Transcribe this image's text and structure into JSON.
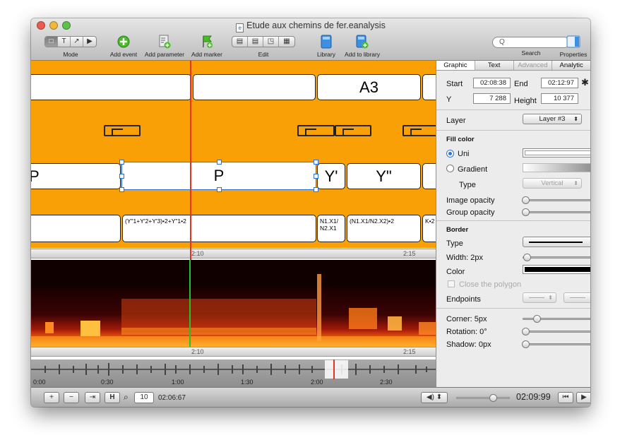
{
  "window": {
    "title": "Etude aux chemins de fer.eanalysis"
  },
  "toolbar": {
    "mode_label": "Mode",
    "mode_buttons": [
      "□",
      "T",
      "↗",
      "▶"
    ],
    "add_event": "Add event",
    "add_parameter": "Add parameter",
    "add_marker": "Add marker",
    "edit_label": "Edit",
    "library": "Library",
    "add_to_library": "Add to library",
    "search_label": "Search",
    "search_placeholder": "Q",
    "properties": "Properties"
  },
  "timeline": {
    "row1": {
      "text": "A3"
    },
    "row3": {
      "p": "P",
      "yprime": "Y'",
      "ydouble": "Y\"",
      "left": "P"
    },
    "row4": {
      "formula": "(Y\"1+Y'2+Y'3)•2+Y\"1•2",
      "n1": "N1.X1/ N2.X1",
      "n2": "(N1.X1/N2.X2)•2",
      "k": "K•2"
    },
    "ruler": {
      "mark1": "2:10",
      "mark2": "2:15"
    },
    "ruler2": {
      "mark1": "2:10",
      "mark2": "2:15"
    },
    "overview": [
      "0:00",
      "0:30",
      "1:00",
      "1:30",
      "2:00",
      "2:30"
    ]
  },
  "bottombar": {
    "plus": "+",
    "minus": "−",
    "fit": "⇥",
    "h": "H",
    "zoom": "10",
    "time": "02:06:67",
    "playtime": "02:09:99",
    "rewind": "⏮",
    "play": "▶"
  },
  "inspector": {
    "tabs": [
      "Graphic",
      "Text",
      "Advanced",
      "Analytic"
    ],
    "start_label": "Start",
    "start": "02:08:38",
    "end_label": "End",
    "end": "02:12:97",
    "y_label": "Y",
    "y": "7 288",
    "height_label": "Height",
    "height": "10 377",
    "layer_label": "Layer",
    "layer_value": "Layer #3",
    "fill_color": "Fill color",
    "uni": "Uni",
    "gradient": "Gradient",
    "type_label": "Type",
    "type_value": "Vertical",
    "image_opacity": "Image opacity",
    "group_opacity": "Group opacity",
    "border": "Border",
    "border_type": "Type",
    "width": "Width:  2px",
    "color": "Color",
    "close_polygon": "Close the polygon",
    "endpoints": "Endpoints",
    "corner": "Corner:  5px",
    "rotation": "Rotation:  0°",
    "shadow": "Shadow:  0px"
  },
  "colors": {
    "accent": "#f9a006",
    "playhead": "#e8321e",
    "selection": "#2d73d4"
  }
}
